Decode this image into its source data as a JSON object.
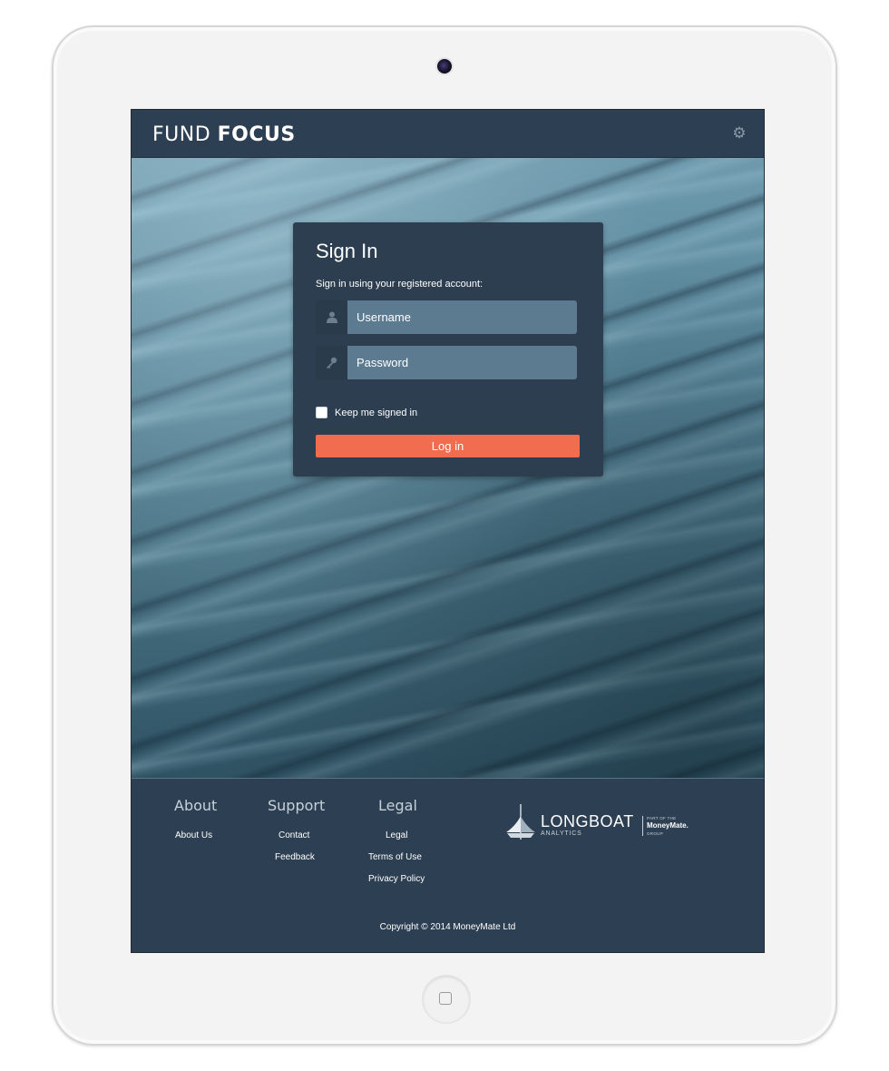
{
  "header": {
    "brand_light": "FUND ",
    "brand_bold": "FOCUS",
    "settings_icon": "gear-icon"
  },
  "signin": {
    "title": "Sign In",
    "subtitle": "Sign in using your registered account:",
    "username_placeholder": "Username",
    "username_icon": "user-icon",
    "password_placeholder": "Password",
    "password_icon": "key-icon",
    "keep_signed_in": "Keep me signed in",
    "keep_signed_in_checked": false,
    "login_label": "Log in"
  },
  "footer": {
    "columns": [
      {
        "heading": "About",
        "links": [
          "About Us"
        ]
      },
      {
        "heading": "Support",
        "links": [
          "Contact",
          "Feedback"
        ]
      },
      {
        "heading": "Legal",
        "links": [
          "Legal",
          "Terms of Use",
          "Privacy Policy"
        ]
      }
    ],
    "logo": {
      "name": "LONGBOAT",
      "sub": "ANALYTICS",
      "part_of": "PART OF THE",
      "group_name": "MoneyMate.",
      "group": "GROUP"
    },
    "copyright": "Copyright © 2014 MoneyMate Ltd"
  },
  "colors": {
    "navy": "#2c3e50",
    "input_bg": "#5c7b90",
    "login_button": "#f26c4f"
  }
}
